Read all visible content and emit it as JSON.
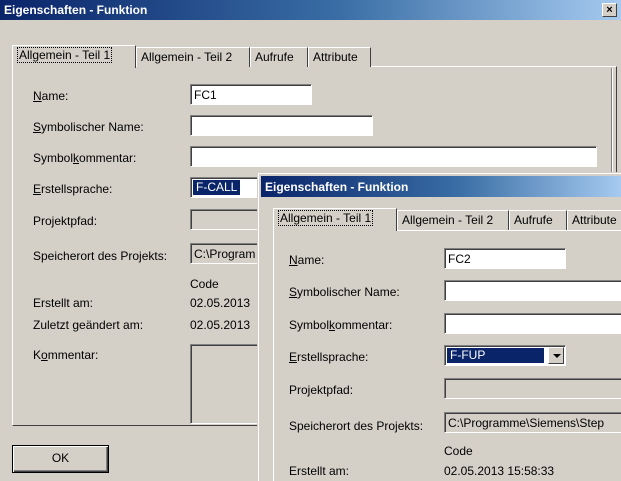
{
  "back_dialog": {
    "title": "Eigenschaften - Funktion",
    "close_glyph": "×",
    "tabs": [
      "Allgemein - Teil 1",
      "Allgemein - Teil 2",
      "Aufrufe",
      "Attribute"
    ],
    "labels": {
      "name": [
        "",
        "N",
        "ame:"
      ],
      "symbolic_name": [
        "",
        "S",
        "ymbolischer Name:"
      ],
      "symbol_comment": [
        "Symbol",
        "k",
        "ommentar:"
      ],
      "language": [
        "",
        "E",
        "rstellsprache:"
      ],
      "project_path": "Projektpfad:",
      "storage_location": "Speicherort des Projekts:",
      "code_header": "Code",
      "created": "Erstellt am:",
      "modified": "Zuletzt geändert am:",
      "comment": [
        "K",
        "o",
        "mmentar:"
      ]
    },
    "values": {
      "name": "FC1",
      "symbolic_name": "",
      "symbol_comment": "",
      "language": "F-CALL",
      "project_path": "",
      "storage_location": "C:\\Program",
      "created": "02.05.2013",
      "modified": "02.05.2013"
    },
    "ok_label": "OK"
  },
  "front_dialog": {
    "title": "Eigenschaften - Funktion",
    "tabs": [
      "Allgemein - Teil 1",
      "Allgemein - Teil 2",
      "Aufrufe",
      "Attribute"
    ],
    "labels": {
      "name": [
        "",
        "N",
        "ame:"
      ],
      "symbolic_name": [
        "",
        "S",
        "ymbolischer Name:"
      ],
      "symbol_comment": [
        "Symbol",
        "k",
        "ommentar:"
      ],
      "language": [
        "",
        "E",
        "rstellsprache:"
      ],
      "project_path": "Projektpfad:",
      "storage_location": "Speicherort des Projekts:",
      "code_header": "Code",
      "created": "Erstellt am:"
    },
    "values": {
      "name": "FC2",
      "symbolic_name": "",
      "symbol_comment": "",
      "language": "F-FUP",
      "project_path": "",
      "storage_location": "C:\\Programme\\Siemens\\Step",
      "created": "02.05.2013 15:58:33"
    }
  }
}
